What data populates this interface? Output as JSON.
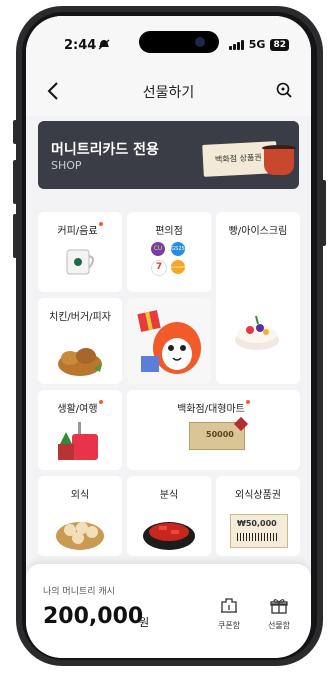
{
  "status_bar": {
    "time": "2:44",
    "network": "5G",
    "battery": "82"
  },
  "header": {
    "title": "선물하기"
  },
  "banner": {
    "title": "머니트리카드 전용",
    "subtitle": "SHOP",
    "voucher_text": "백화점 상품권"
  },
  "categories": [
    {
      "label": "커피/음료",
      "new": true
    },
    {
      "label": "편의점",
      "new": false
    },
    {
      "label": "빵/아이스크림",
      "new": false
    },
    {
      "label": "치킨/버거/피자",
      "new": false
    },
    {
      "label": "생활/여행",
      "new": true
    },
    {
      "label": "백화점/대형마트",
      "new": true
    },
    {
      "label": "외식",
      "new": false
    },
    {
      "label": "분식",
      "new": false
    },
    {
      "label": "외식상품권",
      "new": false
    }
  ],
  "convenience_logos": [
    "CU",
    "GS25",
    "7",
    "e-mart24"
  ],
  "voucher_amounts": {
    "department": "50000",
    "dining": "₩50,000"
  },
  "bottom_sheet": {
    "cash_label": "나의 머니트리 캐시",
    "cash_amount": "200,000",
    "cash_unit": "원",
    "coupon_label": "쿠폰함",
    "gift_label": "선물함"
  },
  "colors": {
    "accent_dot": "#ff5a2c",
    "banner_bg": "#3a3d45"
  }
}
